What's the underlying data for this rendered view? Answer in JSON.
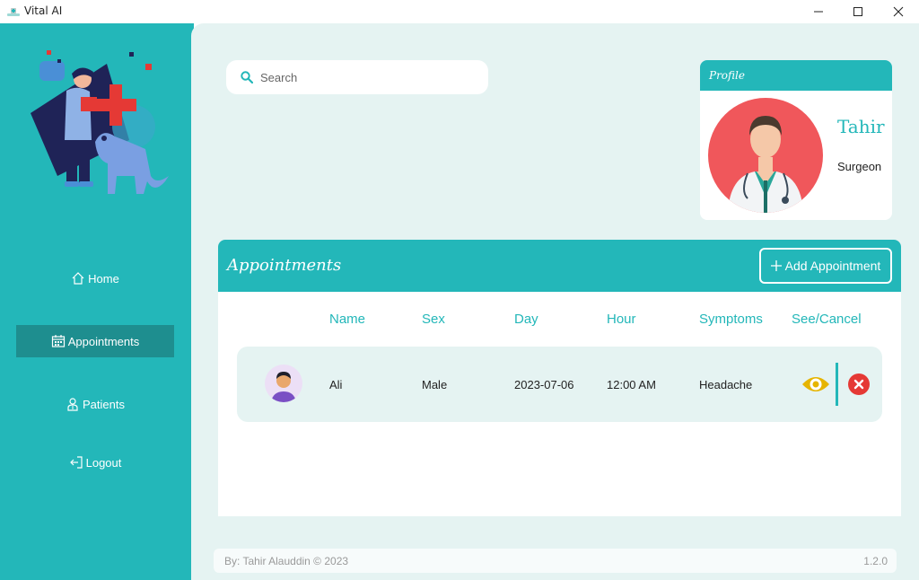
{
  "window": {
    "title": "Vital AI"
  },
  "sidebar": {
    "items": [
      {
        "label": "Home",
        "icon": "home-icon"
      },
      {
        "label": "Appointments",
        "icon": "calendar-icon",
        "active": true
      },
      {
        "label": "Patients",
        "icon": "patient-icon"
      },
      {
        "label": "Logout",
        "icon": "logout-icon"
      }
    ]
  },
  "search": {
    "placeholder": "Search",
    "value": ""
  },
  "profile": {
    "header": "Profile",
    "name": "Tahir",
    "role": "Surgeon"
  },
  "appointments": {
    "title": "Appointments",
    "add_label": "Add Appointment",
    "columns": [
      "Name",
      "Sex",
      "Day",
      "Hour",
      "Symptoms",
      "See/Cancel"
    ],
    "rows": [
      {
        "name": "Ali",
        "sex": "Male",
        "day": "2023-07-06",
        "hour": "12:00 AM",
        "symptoms": "Headache"
      }
    ]
  },
  "footer": {
    "credit": "By: Tahir Alauddin © 2023",
    "version": "1.2.0"
  },
  "colors": {
    "accent": "#23b7b9",
    "accent_dark": "#1e8e8f",
    "background": "#e5f3f2",
    "eye": "#e6b400",
    "cancel": "#e53935"
  }
}
